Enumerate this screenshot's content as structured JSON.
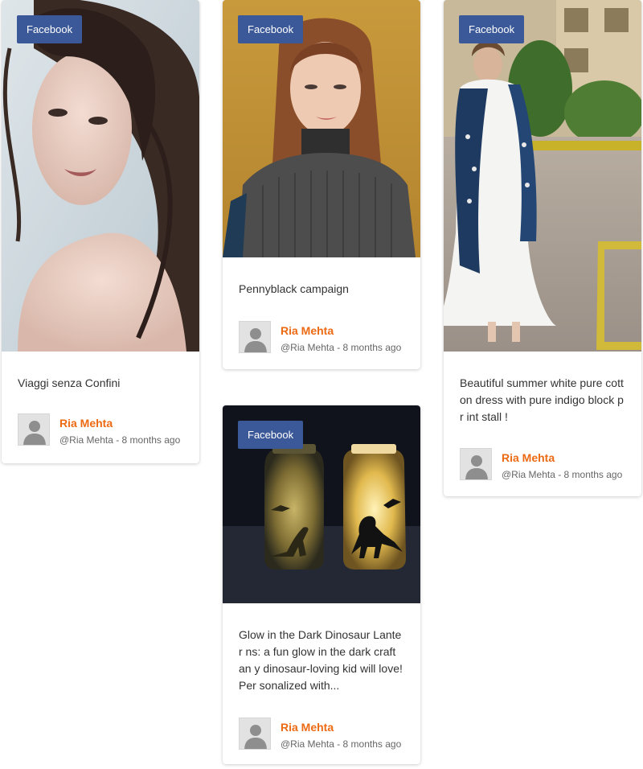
{
  "brand_colors": {
    "facebook_badge": "#3b5998",
    "author_name": "#ec6a13"
  },
  "posts": [
    {
      "network": "Facebook",
      "caption": "Viaggi senza Confini",
      "author_name": "Ria Mehta",
      "author_meta": "@Ria Mehta - 8 months ago",
      "avatar_icon": "user-icon"
    },
    {
      "network": "Facebook",
      "caption": "Pennyblack campaign",
      "author_name": "Ria Mehta",
      "author_meta": "@Ria Mehta - 8 months ago",
      "avatar_icon": "user-icon"
    },
    {
      "network": "Facebook",
      "caption": "Beautiful summer white pure cott on dress with pure indigo block pr int stall !",
      "author_name": "Ria Mehta",
      "author_meta": "@Ria Mehta - 8 months ago",
      "avatar_icon": "user-icon"
    },
    {
      "network": "Facebook",
      "caption": "Glow in the Dark Dinosaur Lanter ns: a fun glow in the dark craft an y dinosaur-loving kid will love! Per sonalized with...",
      "author_name": "Ria Mehta",
      "author_meta": "@Ria Mehta - 8 months ago",
      "avatar_icon": "user-icon"
    }
  ]
}
